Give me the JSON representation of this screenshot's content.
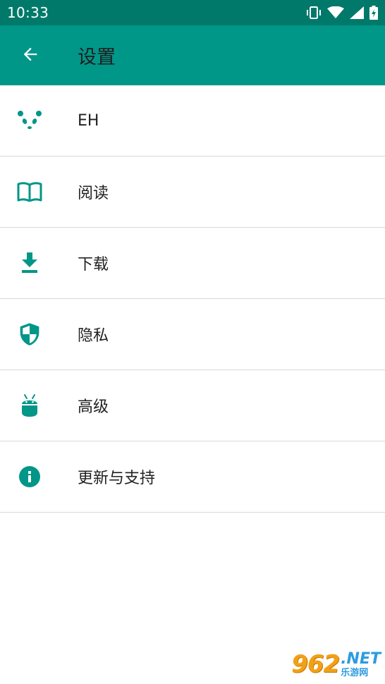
{
  "status_bar": {
    "time": "10:33",
    "icons": [
      "vibrate-icon",
      "wifi-icon",
      "signal-icon",
      "battery-charging-icon"
    ]
  },
  "app_bar": {
    "title": "设置",
    "back_icon": "arrow-back-icon"
  },
  "settings": [
    {
      "label": "EH",
      "icon": "panda-icon"
    },
    {
      "label": "阅读",
      "icon": "book-icon"
    },
    {
      "label": "下载",
      "icon": "download-icon"
    },
    {
      "label": "隐私",
      "icon": "security-shield-icon"
    },
    {
      "label": "高级",
      "icon": "android-icon"
    },
    {
      "label": "更新与支持",
      "icon": "info-icon"
    }
  ],
  "watermark": {
    "number": "962",
    "domain": ".NET",
    "site": "乐游网"
  },
  "colors": {
    "status_bar": "#00796b",
    "app_bar": "#009688",
    "accent": "#009688"
  }
}
